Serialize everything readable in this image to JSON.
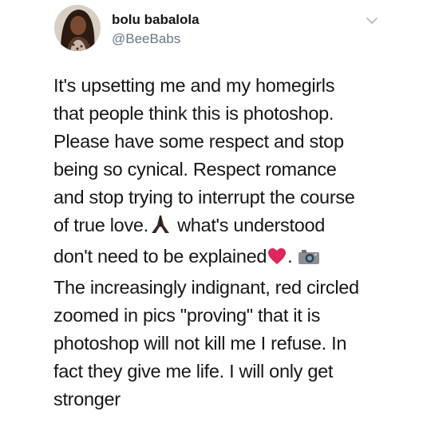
{
  "tweet": {
    "display_name": "bolu babalola",
    "handle": "@BeeBabs",
    "lines": [
      "It's upsetting me and my homegirls",
      "that people think this is photoshop.",
      "Please have some respect and stop",
      "being so cynical. Respect romance",
      "and stop trying to interrupt the course"
    ],
    "line6_before": "of true love.",
    "line6_after": " what's understood",
    "line7_before": "don't need to be explained",
    "line7_after": ".",
    "lines_after": [
      "The increasingly indignant, red circled",
      "zoomed in pics \"proving\" that it is",
      "photoshop will not kill me I refuse. In",
      "fact they give me life. I will only get",
      "stronger"
    ],
    "icons": {
      "avatar": "avatar",
      "menu": "chevron-down-icon",
      "emoji_1": "praying-hands-emoji",
      "emoji_2": "red-heart-emoji",
      "emoji_3": "camera-emoji"
    },
    "colors": {
      "handle": "#657786",
      "text": "#14171a",
      "heart": "#e0245e"
    }
  }
}
